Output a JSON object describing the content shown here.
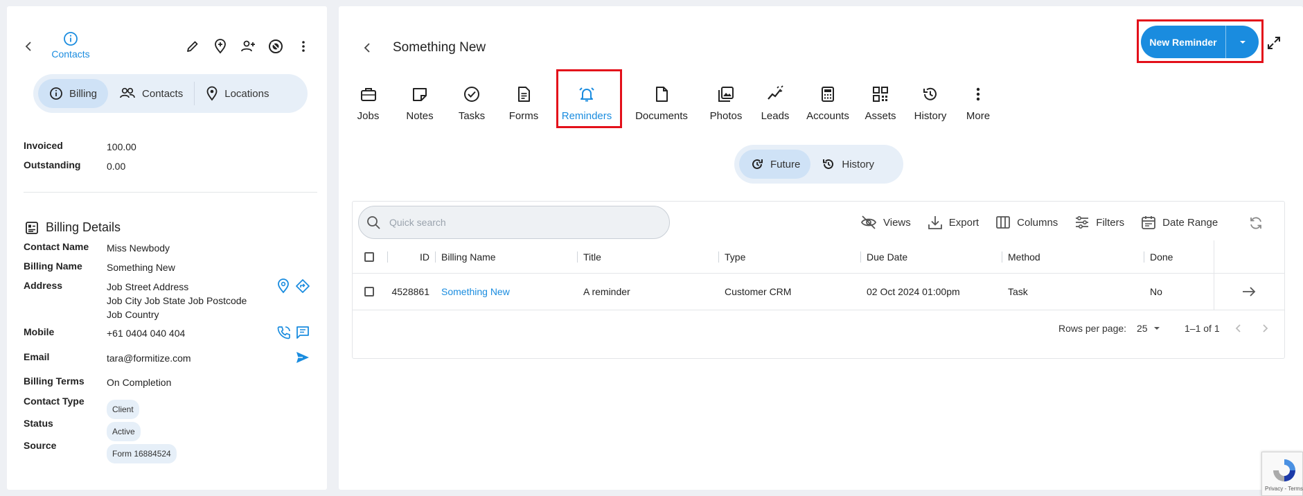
{
  "colors": {
    "accent": "#1a8cdf",
    "highlight": "#e3101a",
    "segment_bg": "#e7eff8",
    "segment_active": "#cfe2f6"
  },
  "left": {
    "header": {
      "back_icon": "chevron-left-icon",
      "contacts_label": "Contacts",
      "contacts_icon": "info-circle-icon"
    },
    "actions": [
      "pencil-icon",
      "location-plus-icon",
      "person-add-icon",
      "shield-icon",
      "more-vertical-icon"
    ],
    "segments": [
      {
        "label": "Billing",
        "icon": "info-circle-icon",
        "active": true
      },
      {
        "label": "Contacts",
        "icon": "people-icon",
        "active": false
      },
      {
        "label": "Locations",
        "icon": "location-pin-icon",
        "active": false
      }
    ],
    "summary": {
      "invoiced_label": "Invoiced",
      "invoiced_value": "100.00",
      "outstanding_label": "Outstanding",
      "outstanding_value": "0.00"
    },
    "billing_details": {
      "title": "Billing Details",
      "contact_name_label": "Contact Name",
      "contact_name": "Miss Newbody",
      "billing_name_label": "Billing Name",
      "billing_name": "Something New",
      "address_label": "Address",
      "address_line1": "Job Street Address",
      "address_line2": "Job City Job State Job Postcode",
      "address_line3": "Job Country",
      "mobile_label": "Mobile",
      "mobile": "+61 0404 040 404",
      "email_label": "Email",
      "email": "tara@formitize.com",
      "billing_terms_label": "Billing Terms",
      "billing_terms": "On Completion",
      "contact_type_label": "Contact Type",
      "contact_type": "Client",
      "status_label": "Status",
      "status": "Active",
      "source_label": "Source",
      "source": "Form 16884524"
    }
  },
  "main": {
    "title": "Something New",
    "new_reminder_label": "New Reminder",
    "tabs": [
      {
        "label": "Jobs",
        "icon": "briefcase-icon"
      },
      {
        "label": "Notes",
        "icon": "note-icon"
      },
      {
        "label": "Tasks",
        "icon": "check-circle-icon"
      },
      {
        "label": "Forms",
        "icon": "document-lines-icon"
      },
      {
        "label": "Reminders",
        "icon": "bell-alarm-icon",
        "active": true
      },
      {
        "label": "Documents",
        "icon": "document-icon"
      },
      {
        "label": "Photos",
        "icon": "photos-icon"
      },
      {
        "label": "Leads",
        "icon": "leads-icon"
      },
      {
        "label": "Accounts",
        "icon": "calculator-icon"
      },
      {
        "label": "Assets",
        "icon": "qr-code-icon"
      },
      {
        "label": "History",
        "icon": "history-icon"
      },
      {
        "label": "More",
        "icon": "more-vertical-icon"
      }
    ],
    "filter_toggle": {
      "future": "Future",
      "history": "History"
    },
    "grid": {
      "search_placeholder": "Quick search",
      "toolbar": {
        "views": "Views",
        "export": "Export",
        "columns": "Columns",
        "filters": "Filters",
        "date_range": "Date Range"
      },
      "columns": [
        "ID",
        "Billing Name",
        "Title",
        "Type",
        "Due Date",
        "Method",
        "Done"
      ],
      "rows": [
        {
          "id": "4528861",
          "billing_name": "Something New",
          "title": "A reminder",
          "type": "Customer CRM",
          "due_date": "02 Oct 2024 01:00pm",
          "method": "Task",
          "done": "No"
        }
      ],
      "pagination": {
        "rows_per_page_label": "Rows per page:",
        "rows_per_page": "25",
        "range": "1–1 of 1"
      }
    }
  },
  "recaptcha": {
    "text": "Privacy - Terms"
  }
}
